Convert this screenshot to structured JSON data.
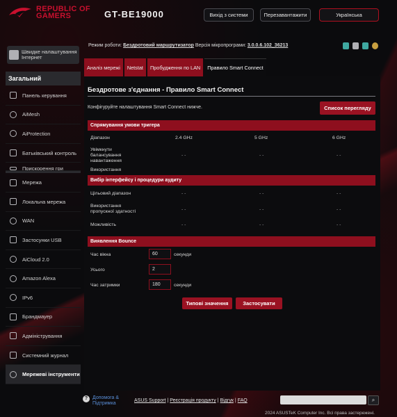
{
  "header": {
    "logo_line1": "REPUBLIC OF",
    "logo_line2": "GAMERS",
    "model": "GT-BE19000",
    "logout": "Вихід з системи",
    "reboot": "Перезавантажити",
    "language": "Українська"
  },
  "sidebar": {
    "quick_setup": "Швидке налаштування Інтернет",
    "section_title": "Загальний",
    "general_items": [
      {
        "label": "Панель керування",
        "icon": "dashboard-icon"
      },
      {
        "label": "AiMesh",
        "icon": "mesh-icon"
      },
      {
        "label": "AiProtection",
        "icon": "shield-icon"
      },
      {
        "label": "Батьківський контроль",
        "icon": "parental-icon"
      },
      {
        "label": "Прискорення гри",
        "icon": "game-icon"
      }
    ],
    "advanced_items": [
      {
        "label": "Мережа",
        "icon": "network-icon"
      },
      {
        "label": "Локальна мережа",
        "icon": "lan-icon"
      },
      {
        "label": "WAN",
        "icon": "globe-icon"
      },
      {
        "label": "Застосунки USB",
        "icon": "usb-icon"
      },
      {
        "label": "AiCloud 2.0",
        "icon": "cloud-icon"
      },
      {
        "label": "Amazon Alexa",
        "icon": "alexa-icon"
      },
      {
        "label": "IPv6",
        "icon": "ipv6-icon"
      },
      {
        "label": "Брандмауер",
        "icon": "firewall-icon"
      },
      {
        "label": "Адміністрування",
        "icon": "admin-icon"
      },
      {
        "label": "Системний журнал",
        "icon": "log-icon"
      },
      {
        "label": "Мережеві інструменти",
        "icon": "tools-icon"
      }
    ]
  },
  "info": {
    "mode_label": "Режим роботи:",
    "mode_value": "Бездротовий маршрутизатор",
    "fw_label": "Версія мікропрограми:",
    "fw_value": "3.0.0.6.102_36213"
  },
  "tabs": [
    "Аналіз мережі",
    "Netstat",
    "Пробудження по LAN",
    "Правило Smart Connect"
  ],
  "panel": {
    "title": "Бездротове з'єднання - Правило Smart Connect",
    "description": "Конфігуруйте налаштування Smart Connect нижче.",
    "list_button": "Список перегляду"
  },
  "trigger": {
    "heading": "Спрямування умови тригера",
    "band_label": "Діапазон",
    "bands": [
      "2.4 GHz",
      "5 GHz",
      "6 GHz"
    ],
    "rows": [
      {
        "label": "Увімкнути балансування навантаження",
        "values": [
          "- -",
          "- -",
          "- -"
        ]
      },
      {
        "label": "Використання",
        "values": [
          "",
          "",
          ""
        ]
      }
    ]
  },
  "steering": {
    "heading": "Вибір інтерфейсу і процедури аудиту",
    "rows": [
      {
        "label": "Цільовий діапазон",
        "values": [
          "- -",
          "- -",
          "- -"
        ]
      },
      {
        "label": "Використання пропускної здатності",
        "values": [
          "- -",
          "- -",
          "- -"
        ]
      },
      {
        "label": "Можливість",
        "values": [
          "- -",
          "- -",
          "- -"
        ]
      }
    ]
  },
  "bounce": {
    "heading": "Виявлення Bounce",
    "rows": [
      {
        "label": "Час вікна",
        "value": "60",
        "unit": "секунди"
      },
      {
        "label": "Усього",
        "value": "2",
        "unit": ""
      },
      {
        "label": "Час затримки",
        "value": "180",
        "unit": "секунди"
      }
    ]
  },
  "actions": {
    "defaults": "Типові значення",
    "apply": "Застосувати"
  },
  "footer": {
    "help": "Допомога & Підтримка",
    "links": [
      "ASUS Support",
      "Реєстрація продукту",
      "Відгук",
      "FAQ"
    ],
    "copyright": "2024 ASUSTeK Computer Inc. Всі права застережені."
  },
  "colors": {
    "accent": "#8e0f1e",
    "background": "#0b0b0d",
    "link": "#5a8fd8"
  }
}
